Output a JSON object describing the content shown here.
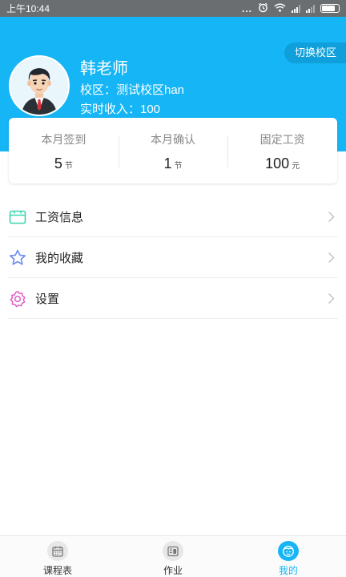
{
  "status_bar": {
    "time": "上午10:44",
    "dots": "..."
  },
  "header": {
    "switch_label": "切换校区",
    "teacher_name": "韩老师",
    "campus_line": "校区：测试校区han",
    "income_line": "实时收入：100"
  },
  "stats": [
    {
      "label": "本月签到",
      "value": "5",
      "unit": "节"
    },
    {
      "label": "本月确认",
      "value": "1",
      "unit": "节"
    },
    {
      "label": "固定工资",
      "value": "100",
      "unit": "元"
    }
  ],
  "menu": [
    {
      "label": "工资信息",
      "icon": "wallet-icon"
    },
    {
      "label": "我的收藏",
      "icon": "star-icon"
    },
    {
      "label": "设置",
      "icon": "gear-icon"
    }
  ],
  "tabs": [
    {
      "label": "课程表",
      "icon": "calendar-icon",
      "active": false
    },
    {
      "label": "作业",
      "icon": "homework-icon",
      "active": false
    },
    {
      "label": "我的",
      "icon": "profile-icon",
      "active": true
    }
  ],
  "colors": {
    "primary": "#16b5f5",
    "wallet_icon": "#3fd6b0",
    "star_icon": "#6a8cf0",
    "gear_icon": "#e25bc4"
  }
}
